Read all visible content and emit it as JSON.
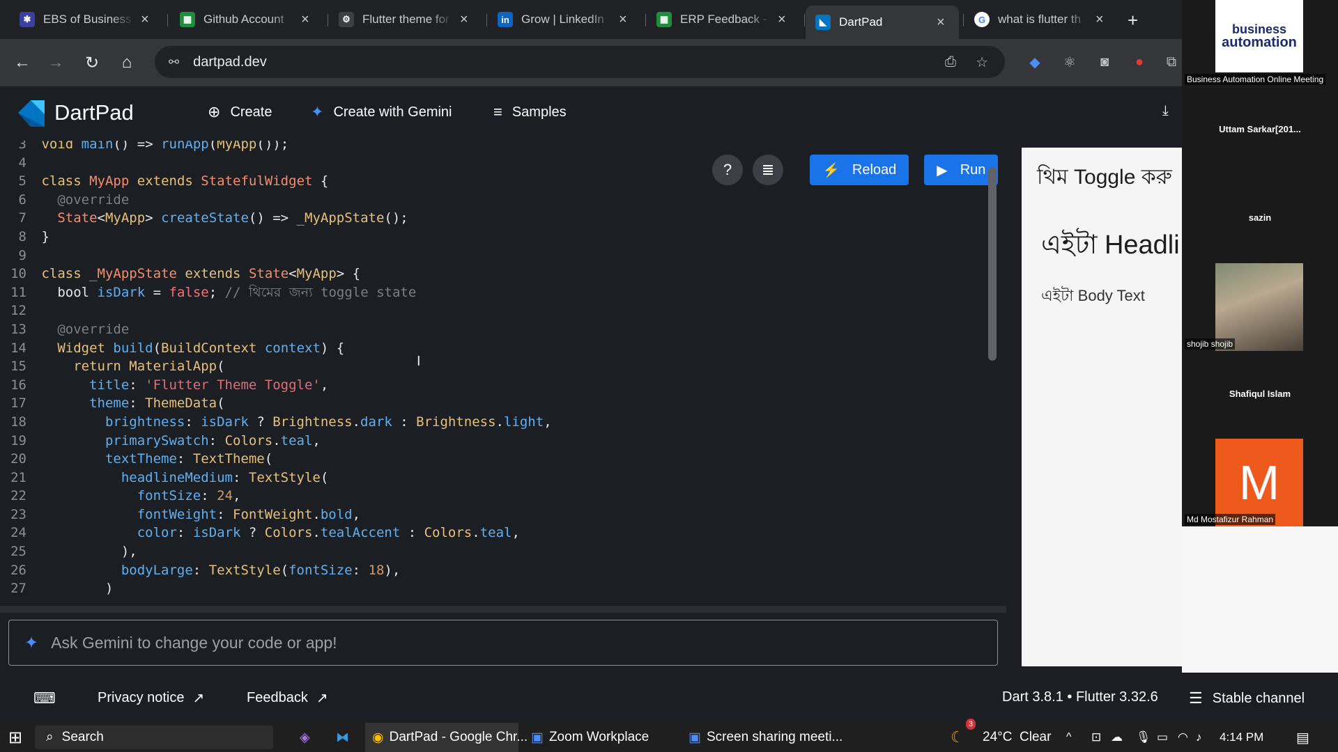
{
  "browser": {
    "tabs": [
      {
        "title": "EBS of Business A",
        "icon": "bizauto-icon",
        "color": "#3b3f9e",
        "glyph": "✱"
      },
      {
        "title": "Github Account",
        "icon": "sheets-icon",
        "color": "#1e8e3e",
        "glyph": "▦"
      },
      {
        "title": "Flutter theme for",
        "icon": "openai-icon",
        "color": "#3c4043",
        "glyph": "⚙"
      },
      {
        "title": "Grow | LinkedIn",
        "icon": "linkedin-icon",
        "color": "#0a66c2",
        "glyph": "in"
      },
      {
        "title": "ERP Feedback - G",
        "icon": "sheets-icon",
        "color": "#1e8e3e",
        "glyph": "▦"
      },
      {
        "title": "DartPad",
        "icon": "dartpad-icon",
        "color": "#0175c2",
        "glyph": "◣"
      },
      {
        "title": "what is flutter th",
        "icon": "google-icon",
        "color": "#ffffff",
        "glyph": "G"
      }
    ],
    "url": "dartpad.dev"
  },
  "app": {
    "name": "DartPad",
    "menu": {
      "create": "Create",
      "gemini": "Create with Gemini",
      "samples": "Samples"
    }
  },
  "editor": {
    "reload_label": "Reload",
    "run_label": "Run"
  },
  "code_lines": [
    {
      "n": "3",
      "html": "<span class='kw'>void</span> <span class='fn'>main</span><span class='pl'>() =&gt; </span><span class='fn'>runApp</span><span class='pl'>(</span><span class='kw'>MyApp</span><span class='pl'>());</span>"
    },
    {
      "n": "4",
      "html": ""
    },
    {
      "n": "5",
      "html": "<span class='kw'>class</span> <span class='cls'>MyApp</span> <span class='kw'>extends</span> <span class='cls'>StatefulWidget</span><span class='pl'> {</span>"
    },
    {
      "n": "6",
      "html": "  <span class='cm'>@override</span>"
    },
    {
      "n": "7",
      "html": "  <span class='cls'>State</span><span class='pl'>&lt;</span><span class='kw'>MyApp</span><span class='pl'>&gt; </span><span class='fn'>createState</span><span class='pl'>() =&gt; </span><span class='kw'>_MyAppState</span><span class='pl'>();</span>"
    },
    {
      "n": "8",
      "html": "<span class='pl'>}</span>"
    },
    {
      "n": "9",
      "html": ""
    },
    {
      "n": "10",
      "html": "<span class='kw'>class</span> <span class='cls'>_MyAppState</span> <span class='kw'>extends</span> <span class='cls'>State</span><span class='pl'>&lt;</span><span class='kw'>MyApp</span><span class='pl'>&gt; {</span>"
    },
    {
      "n": "11",
      "html": "  <span class='pl'>bool </span><span class='fn'>isDark</span><span class='pl'> = </span><span class='kw2'>false</span><span class='pl'>; </span><span class='cm'>// থিমের জন্য toggle state</span>"
    },
    {
      "n": "12",
      "html": ""
    },
    {
      "n": "13",
      "html": "  <span class='cm'>@override</span>"
    },
    {
      "n": "14",
      "html": "  <span class='kw'>Widget</span> <span class='fn'>build</span><span class='pl'>(</span><span class='kw'>BuildContext</span> <span class='fn'>context</span><span class='pl'>) {</span>"
    },
    {
      "n": "15",
      "html": "    <span class='kw'>return</span> <span class='kw'>MaterialApp</span><span class='pl'>(</span>"
    },
    {
      "n": "16",
      "html": "      <span class='prop'>title</span><span class='pl'>: </span><span class='str'>'Flutter Theme Toggle'</span><span class='pl'>,</span>"
    },
    {
      "n": "17",
      "html": "      <span class='prop'>theme</span><span class='pl'>: </span><span class='kw'>ThemeData</span><span class='pl'>(</span>"
    },
    {
      "n": "18",
      "html": "        <span class='prop'>brightness</span><span class='pl'>: </span><span class='fn'>isDark</span><span class='pl'> ? </span><span class='kw'>Brightness</span><span class='pl'>.</span><span class='fn'>dark</span><span class='pl'> : </span><span class='kw'>Brightness</span><span class='pl'>.</span><span class='fn'>light</span><span class='pl'>,</span>"
    },
    {
      "n": "19",
      "html": "        <span class='prop'>primarySwatch</span><span class='pl'>: </span><span class='kw'>Colors</span><span class='pl'>.</span><span class='fn'>teal</span><span class='pl'>,</span>"
    },
    {
      "n": "20",
      "html": "        <span class='prop'>textTheme</span><span class='pl'>: </span><span class='kw'>TextTheme</span><span class='pl'>(</span>"
    },
    {
      "n": "21",
      "html": "          <span class='prop'>headlineMedium</span><span class='pl'>: </span><span class='kw'>TextStyle</span><span class='pl'>(</span>"
    },
    {
      "n": "22",
      "html": "            <span class='prop'>fontSize</span><span class='pl'>: </span><span class='num'>24</span><span class='pl'>,</span>"
    },
    {
      "n": "23",
      "html": "            <span class='prop'>fontWeight</span><span class='pl'>: </span><span class='kw'>FontWeight</span><span class='pl'>.</span><span class='fn'>bold</span><span class='pl'>,</span>"
    },
    {
      "n": "24",
      "html": "            <span class='prop'>color</span><span class='pl'>: </span><span class='fn'>isDark</span><span class='pl'> ? </span><span class='kw'>Colors</span><span class='pl'>.</span><span class='fn'>tealAccent</span><span class='pl'> : </span><span class='kw'>Colors</span><span class='pl'>.</span><span class='fn'>teal</span><span class='pl'>,</span>"
    },
    {
      "n": "25",
      "html": "          <span class='pl'>),</span>"
    },
    {
      "n": "26",
      "html": "          <span class='prop'>bodyLarge</span><span class='pl'>: </span><span class='kw'>TextStyle</span><span class='pl'>(</span><span class='prop'>fontSize</span><span class='pl'>: </span><span class='num'>18</span><span class='pl'>),</span>"
    },
    {
      "n": "27",
      "html": "        <span class='pl'>)</span>"
    }
  ],
  "gemini": {
    "placeholder": "Ask Gemini to change your code or app!"
  },
  "preview": {
    "title": "থিম Toggle করু",
    "headline": "এইটা Headli",
    "body": "এইটা Body Text"
  },
  "footer": {
    "privacy": "Privacy notice",
    "feedback": "Feedback",
    "version": "Dart 3.8.1 • Flutter 3.32.6",
    "channel": "Stable channel"
  },
  "zoom": {
    "logo_line1": "business",
    "logo_line2": "automation",
    "meeting_label": "Business Automation Online Meeting",
    "participants": [
      "Uttam Sarkar[201...",
      "sazin",
      "shojib shojib",
      "Shafiqul Islam",
      "Md Mostafizur Rahman"
    ],
    "avatar_letter": "M"
  },
  "taskbar": {
    "search": "Search",
    "apps": [
      "DartPad - Google Chr...",
      "Zoom Workplace",
      "Screen sharing meeti..."
    ],
    "weather_badge": "3",
    "weather": "24°C  Clear",
    "time": "4:14 PM"
  }
}
